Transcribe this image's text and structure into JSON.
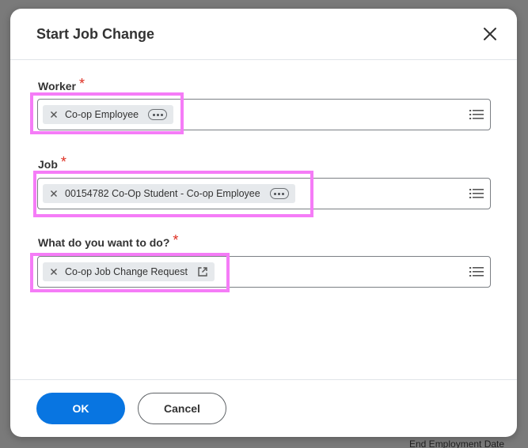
{
  "backdrop": {
    "partial_label": "End Employment Date"
  },
  "dialog": {
    "title": "Start Job Change",
    "close_icon": "close-icon"
  },
  "fields": {
    "worker": {
      "label": "Worker",
      "required_mark": "*",
      "value": "Co-op Employee",
      "remove_icon": "x-icon",
      "options_icon": "ellipsis-icon",
      "prompt_icon": "list-icon"
    },
    "job": {
      "label": "Job",
      "required_mark": "*",
      "value": "00154782 Co-Op Student - Co-op Employee",
      "remove_icon": "x-icon",
      "options_icon": "ellipsis-icon",
      "prompt_icon": "list-icon"
    },
    "action": {
      "label": "What do you want to do?",
      "required_mark": "*",
      "value": "Co-op Job Change Request",
      "remove_icon": "x-icon",
      "open_icon": "external-link-icon",
      "prompt_icon": "list-icon"
    }
  },
  "footer": {
    "ok_label": "OK",
    "cancel_label": "Cancel"
  },
  "colors": {
    "primary": "#0875e1",
    "required": "#de2e21",
    "highlight": "#f57cf7",
    "pill_bg": "#e6e9ec"
  }
}
